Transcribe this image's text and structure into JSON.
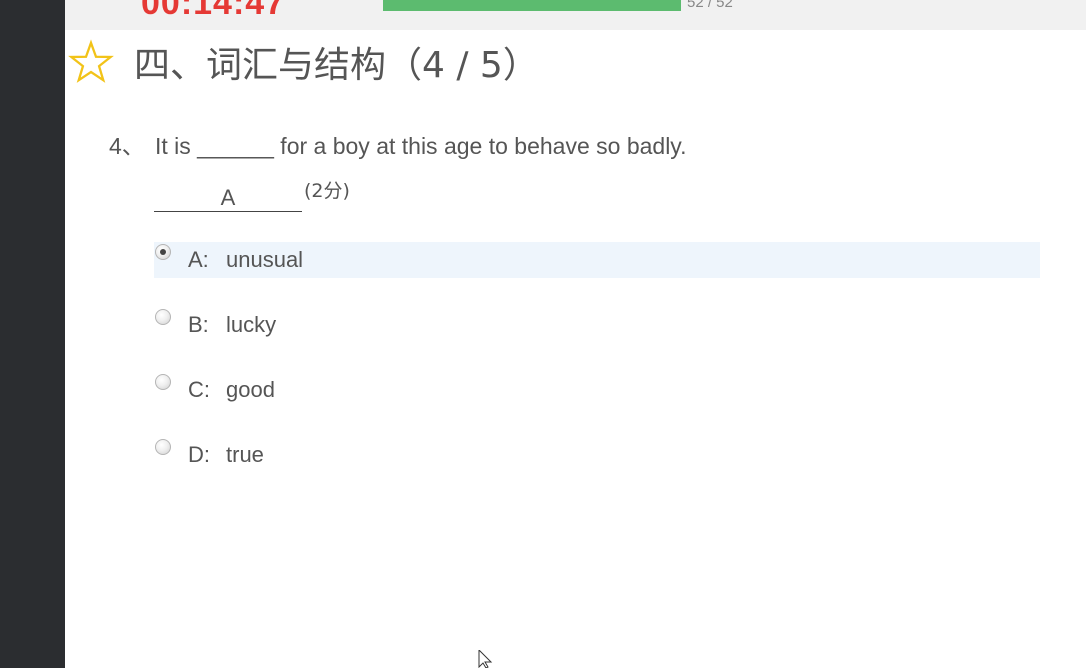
{
  "header": {
    "timer": "00:14:47",
    "progress_text": "52 / 52",
    "progress_fraction": 1.0,
    "progress_color": "#5cbb6f",
    "timer_color": "#e53935"
  },
  "section": {
    "icon": "star-outline-icon",
    "title": "四、词汇与结构（4 / 5）"
  },
  "question": {
    "number": "4、",
    "text": "It is ______ for a boy at this age to behave so badly.",
    "answer": "A",
    "points": "(2分)"
  },
  "options": [
    {
      "letter": "A:",
      "text": "unusual",
      "selected": true
    },
    {
      "letter": "B:",
      "text": "lucky",
      "selected": false
    },
    {
      "letter": "C:",
      "text": "good",
      "selected": false
    },
    {
      "letter": "D:",
      "text": "true",
      "selected": false
    }
  ]
}
